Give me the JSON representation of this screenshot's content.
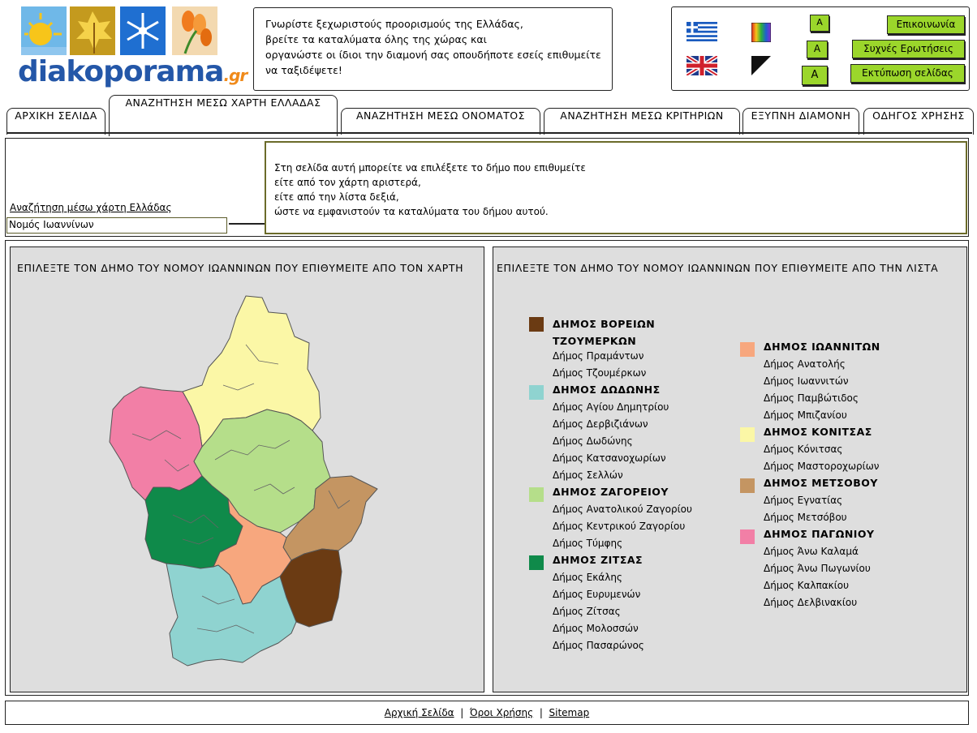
{
  "logo": {
    "name": "diakoporama",
    "suffix": ".gr"
  },
  "intro": {
    "lines": [
      "Γνωρίστε ξεχωριστούς προορισμούς της Ελλάδας,",
      "βρείτε τα καταλύματα όλης της χώρας και",
      "οργανώστε οι ίδιοι την διαμονή σας οπουδήποτε εσείς επιθυμείτε",
      "να ταξιδέψετε!"
    ]
  },
  "topright": {
    "font_size_buttons": [
      "A",
      "A",
      "A"
    ],
    "links": [
      "Επικοινωνία",
      "Συχνές Ερωτήσεις",
      "Εκτύπωση σελίδας"
    ],
    "icons": [
      "greek-flag-icon",
      "uk-flag-icon",
      "color-palette-icon",
      "contrast-icon"
    ]
  },
  "tabs": [
    "ΑΡΧΙΚΗ ΣΕΛΙΔΑ",
    "ΑΝΑΖΗΤΗΣΗ ΜΕΣΩ ΧΑΡΤΗ ΕΛΛΑΔΑΣ",
    "ΑΝΑΖΗΤΗΣΗ ΜΕΣΩ ΟΝΟΜΑΤΟΣ",
    "ΑΝΑΖΗΤΗΣΗ ΜΕΣΩ ΚΡΙΤΗΡΙΩΝ",
    "ΕΞΥΠΝΗ ΔΙΑΜΟΝΗ",
    "ΟΔΗΓΟΣ ΧΡΗΣΗΣ"
  ],
  "breadcrumb": {
    "link": "Αναζήτηση μέσω χάρτη Ελλάδας",
    "current": "Νομός Ιωαννίνων"
  },
  "info": {
    "lines": [
      "Στη σελίδα αυτή μπορείτε να επιλέξετε το δήμο που επιθυμείτε",
      "είτε από τον χάρτη αριστερά,",
      "είτε από την λίστα δεξιά,",
      "ώστε να εμφανιστούν τα καταλύματα του δήμου αυτού."
    ]
  },
  "map_panel": {
    "title": "ΕΠΙΛΕΞΤΕ ΤΟΝ ΔΗΜΟ ΤΟΥ ΝΟΜΟΥ ΙΩΑΝΝΙΝΩΝ ΠΟΥ ΕΠΙΘΥΜΕΙΤΕ ΑΠΟ ΤΟΝ ΧΑΡΤΗ"
  },
  "list_panel": {
    "title": "ΕΠΙΛΕΞΤΕ ΤΟΝ ΔΗΜΟ ΤΟΥ ΝΟΜΟΥ ΙΩΑΝΝΙΝΩΝ ΠΟΥ ΕΠΙΘΥΜΕΙΤΕ ΑΠΟ ΤΗΝ ΛΙΣΤΑ"
  },
  "districts": [
    {
      "name": "ΔΗΜΟΣ ΒΟΡΕΙΩΝ ΤΖΟΥΜΕΡΚΩΝ",
      "color": "#6b3b13",
      "subs": [
        "Δήμος Πραμάντων",
        "Δήμος Τζουμέρκων"
      ]
    },
    {
      "name": "ΔΗΜΟΣ ΔΩΔΩΝΗΣ",
      "color": "#8fd3d0",
      "subs": [
        "Δήμος Αγίου Δημητρίου",
        "Δήμος Δερβιζιάνων",
        "Δήμος Δωδώνης",
        "Δήμος Κατσανοχωρίων",
        "Δήμος Σελλών"
      ]
    },
    {
      "name": "ΔΗΜΟΣ ΖΑΓΟΡΕΙΟΥ",
      "color": "#b5de8a",
      "subs": [
        "Δήμος Ανατολικού Ζαγορίου",
        "Δήμος Κεντρικού Ζαγορίου",
        "Δήμος Τύμφης"
      ]
    },
    {
      "name": "ΔΗΜΟΣ ΖΙΤΣΑΣ",
      "color": "#0f8a4a",
      "subs": [
        "Δήμος Εκάλης",
        "Δήμος Ευρυμενών",
        "Δήμος Ζίτσας",
        "Δήμος Μολοσσών",
        "Δήμος Πασαρώνος"
      ]
    },
    {
      "name": "ΔΗΜΟΣ ΙΩΑΝΝΙΤΩΝ",
      "color": "#f7a77e",
      "subs": [
        "Δήμος Ανατολής",
        "Δήμος Ιωαννιτών",
        "Δήμος Παμβώτιδος",
        "Δήμος Μπιζανίου"
      ]
    },
    {
      "name": "ΔΗΜΟΣ ΚΟΝΙΤΣΑΣ",
      "color": "#fbf7a6",
      "subs": [
        "Δήμος Κόνιτσας",
        "Δήμος Μαστοροχωρίων"
      ]
    },
    {
      "name": "ΔΗΜΟΣ ΜΕΤΣΟΒΟΥ",
      "color": "#c49562",
      "subs": [
        "Δήμος Εγνατίας",
        "Δήμος Μετσόβου"
      ]
    },
    {
      "name": "ΔΗΜΟΣ ΠΑΓΩΝΙΟΥ",
      "color": "#f27fa6",
      "subs": [
        "Δήμος Άνω Καλαμά",
        "Δήμος Άνω Πωγωνίου",
        "Δήμος Καλπακίου",
        "Δήμος Δελβινακίου"
      ]
    }
  ],
  "footer": {
    "links": [
      "Αρχική Σελίδα",
      "Όροι Χρήσης",
      "Sitemap"
    ],
    "separator": "|"
  }
}
